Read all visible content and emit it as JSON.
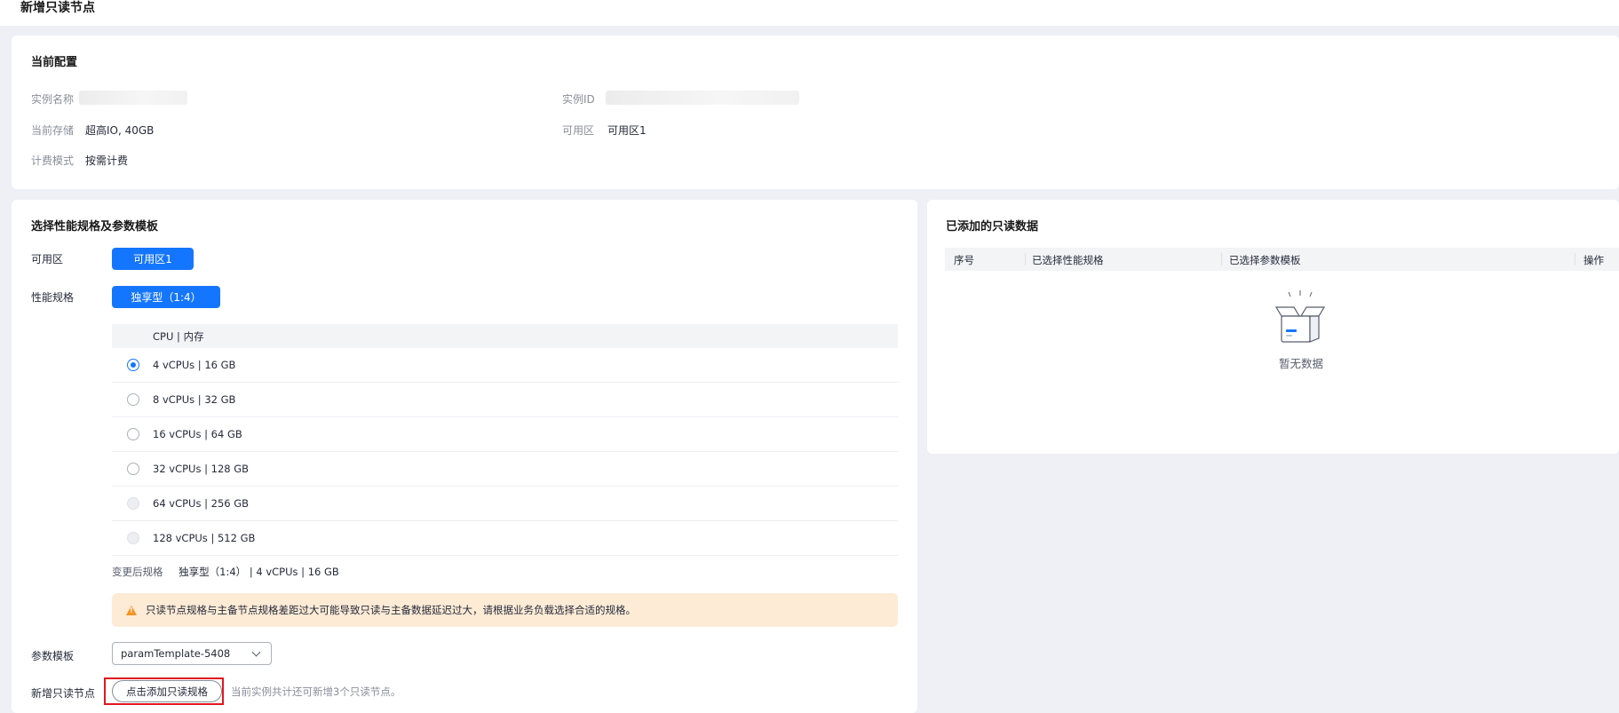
{
  "page": {
    "title": "新增只读节点"
  },
  "current_config": {
    "title": "当前配置",
    "instance_name_label": "实例名称",
    "instance_id_label": "实例ID",
    "storage_label": "当前存储",
    "storage_value": "超高IO, 40GB",
    "zone_label": "可用区",
    "zone_value": "可用区1",
    "billing_label": "计费模式",
    "billing_value": "按需计费"
  },
  "spec_section": {
    "title": "选择性能规格及参数模板",
    "zone_label": "可用区",
    "zone_button": "可用区1",
    "flavor_label": "性能规格",
    "flavor_button": "独享型（1:4）",
    "table_header": "CPU | 内存",
    "rows": [
      {
        "label": "4 vCPUs | 16 GB",
        "state": "checked"
      },
      {
        "label": "8 vCPUs | 32 GB",
        "state": "unchecked"
      },
      {
        "label": "16 vCPUs | 64 GB",
        "state": "unchecked"
      },
      {
        "label": "32 vCPUs | 128 GB",
        "state": "unchecked"
      },
      {
        "label": "64 vCPUs | 256 GB",
        "state": "disabled"
      },
      {
        "label": "128 vCPUs | 512 GB",
        "state": "disabled"
      }
    ],
    "summary_label": "变更后规格",
    "summary_type": "独享型（1:4）",
    "summary_spec": "| 4 vCPUs | 16 GB",
    "warning": "只读节点规格与主备节点规格差距过大可能导致只读与主备数据延迟过大，请根据业务负载选择合适的规格。",
    "param_label": "参数模板",
    "param_value": "paramTemplate-5408",
    "add_label": "新增只读节点",
    "add_button": "点击添加只读规格",
    "add_hint": "当前实例共计还可新增3个只读节点。"
  },
  "added_section": {
    "title": "已添加的只读数据",
    "columns": [
      "序号",
      "已选择性能规格",
      "已选择参数模板",
      "操作"
    ],
    "empty_text": "暂无数据"
  },
  "colors": {
    "primary": "#1476ff",
    "warning_bg": "#fdebd6",
    "warning_icon": "#f7921e",
    "highlight": "#e0181e"
  }
}
